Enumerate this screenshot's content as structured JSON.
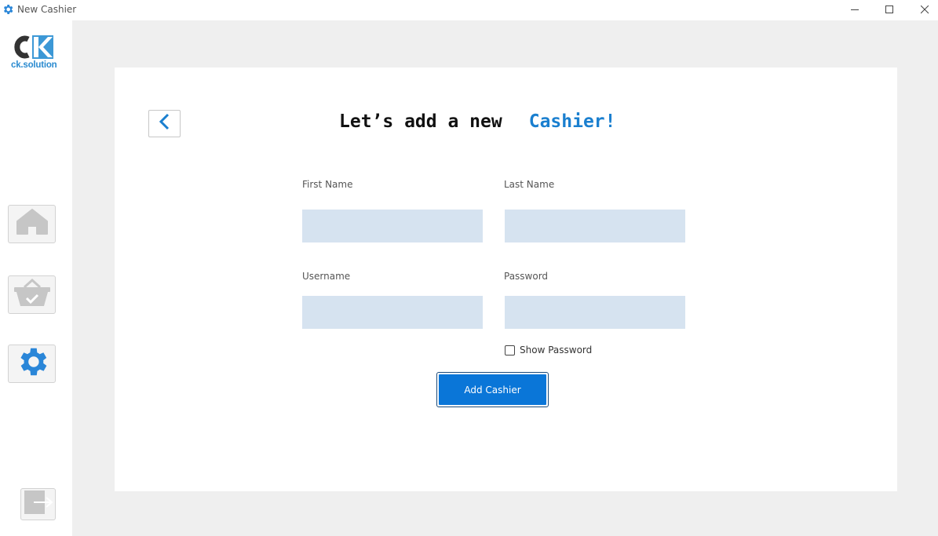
{
  "window": {
    "title": "New Cashier",
    "icon": "gear-icon",
    "controls": [
      "minimize-icon",
      "maximize-icon",
      "close-icon"
    ]
  },
  "sidebar": {
    "logo": {
      "letters": "CK",
      "text": "ck.solution"
    },
    "items": [
      {
        "name": "home",
        "icon": "home-icon"
      },
      {
        "name": "basket",
        "icon": "basket-check-icon"
      },
      {
        "name": "settings",
        "icon": "gear-icon"
      }
    ],
    "logout_icon": "logout-icon"
  },
  "form": {
    "heading_main": "Let’s add a new",
    "heading_accent": "Cashier!",
    "first_name": {
      "label": "First Name",
      "value": ""
    },
    "last_name": {
      "label": "Last Name",
      "value": ""
    },
    "username": {
      "label": "Username",
      "value": ""
    },
    "password": {
      "label": "Password",
      "value": ""
    },
    "show_password_label": "Show Password",
    "show_password_checked": false,
    "submit_label": "Add Cashier"
  },
  "colors": {
    "accent": "#1a7fcf",
    "button": "#0a76d8",
    "input_bg": "#d6e3f0",
    "main_bg": "#efefef"
  }
}
